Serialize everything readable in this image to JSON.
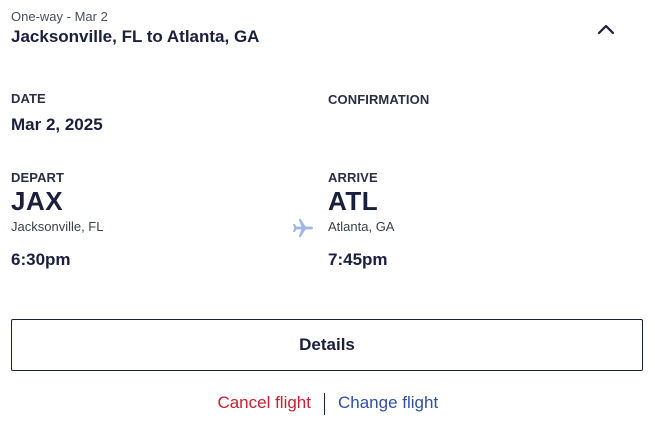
{
  "trip": {
    "subtitle": "One-way - Mar 2",
    "title": "Jacksonville, FL to Atlanta, GA"
  },
  "date": {
    "label": "DATE",
    "value": "Mar 2, 2025"
  },
  "confirmation": {
    "label": "CONFIRMATION",
    "value": ""
  },
  "depart": {
    "label": "DEPART",
    "code": "JAX",
    "city": "Jacksonville, FL",
    "time": "6:30pm"
  },
  "arrive": {
    "label": "ARRIVE",
    "code": "ATL",
    "city": "Atlanta, GA",
    "time": "7:45pm"
  },
  "actions": {
    "details_label": "Details",
    "cancel_label": "Cancel flight",
    "change_label": "Change flight"
  },
  "colors": {
    "navy": "#1a1f3c",
    "cancel_red": "#c8202f",
    "change_blue": "#2f4fa5",
    "plane_light_blue": "#9fb6e6"
  },
  "icons": {
    "collapse": "chevron-up-icon",
    "flight": "airplane-icon"
  }
}
